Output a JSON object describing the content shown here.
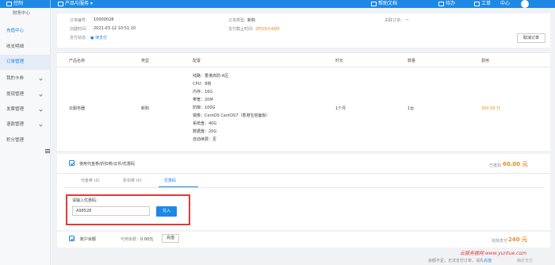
{
  "topbar": {
    "console_label": "控制",
    "products_label": "产品与服务",
    "help_label": "帮助文档",
    "todo_label": "待办",
    "tickets_label": "工单",
    "user_label": "中心"
  },
  "sidebar": {
    "header": "财务中心",
    "items": [
      {
        "label": "充值中心"
      },
      {
        "label": "收支明细"
      },
      {
        "label": "订单管理"
      },
      {
        "label": "我的卡券"
      },
      {
        "label": "提现管理"
      },
      {
        "label": "发票管理"
      },
      {
        "label": "退款管理"
      },
      {
        "label": "积分管理"
      }
    ]
  },
  "order": {
    "number_label": "订单编号:",
    "number": "10000028",
    "type_label": "订单类型:",
    "type": "新购",
    "related_label": "关联订单:",
    "related": "--",
    "created_label": "创建时间:",
    "created": "2021-03-12 10:51:10",
    "deadline_label": "支付截止时间:",
    "deadline": "2时59分48秒",
    "pay_status_label": "支付状态:",
    "pay_status": "待支付",
    "cancel_button": "取消订单"
  },
  "table": {
    "headers": [
      "产品名称",
      "类型",
      "配置",
      "时长",
      "数量",
      "费用"
    ],
    "row": {
      "product": "云服务器",
      "type": "新购",
      "config": [
        "线路：香港高防-A区",
        "CPU：8核",
        "内存：16G",
        "带宽：20M",
        "防御：100G",
        "镜像：CentOS CentOS7（香港宝塔面板）",
        "系统盘：40G",
        "数据盘：20G",
        "自动续费：否"
      ],
      "duration": "1个月",
      "quantity": "1台",
      "price": "300.00 元"
    }
  },
  "discount": {
    "use_label": "使用代金券/折扣券/云币/优惠码",
    "discount_label": "已抵扣",
    "discount_value": "60.00 元",
    "tabs": [
      "代金券 (0)",
      "折扣券 (0)",
      "优惠码"
    ],
    "coupon_label": "请输入优惠码:",
    "coupon_value": "A98528",
    "redeem_button": "兑入"
  },
  "balance": {
    "account_label": "账户余额",
    "available_label": "可用余额：",
    "available_value": "0.00元",
    "recharge_button": "充值",
    "pay_label": "实际支付",
    "pay_value": "240 元"
  },
  "footer": {
    "note": "余额不足，无法支付订单，请先",
    "note_link": "充值",
    "confirm_label": "确定支付"
  },
  "watermark": {
    "brand": "云服务器网",
    "url": "www.yuntue.com"
  }
}
